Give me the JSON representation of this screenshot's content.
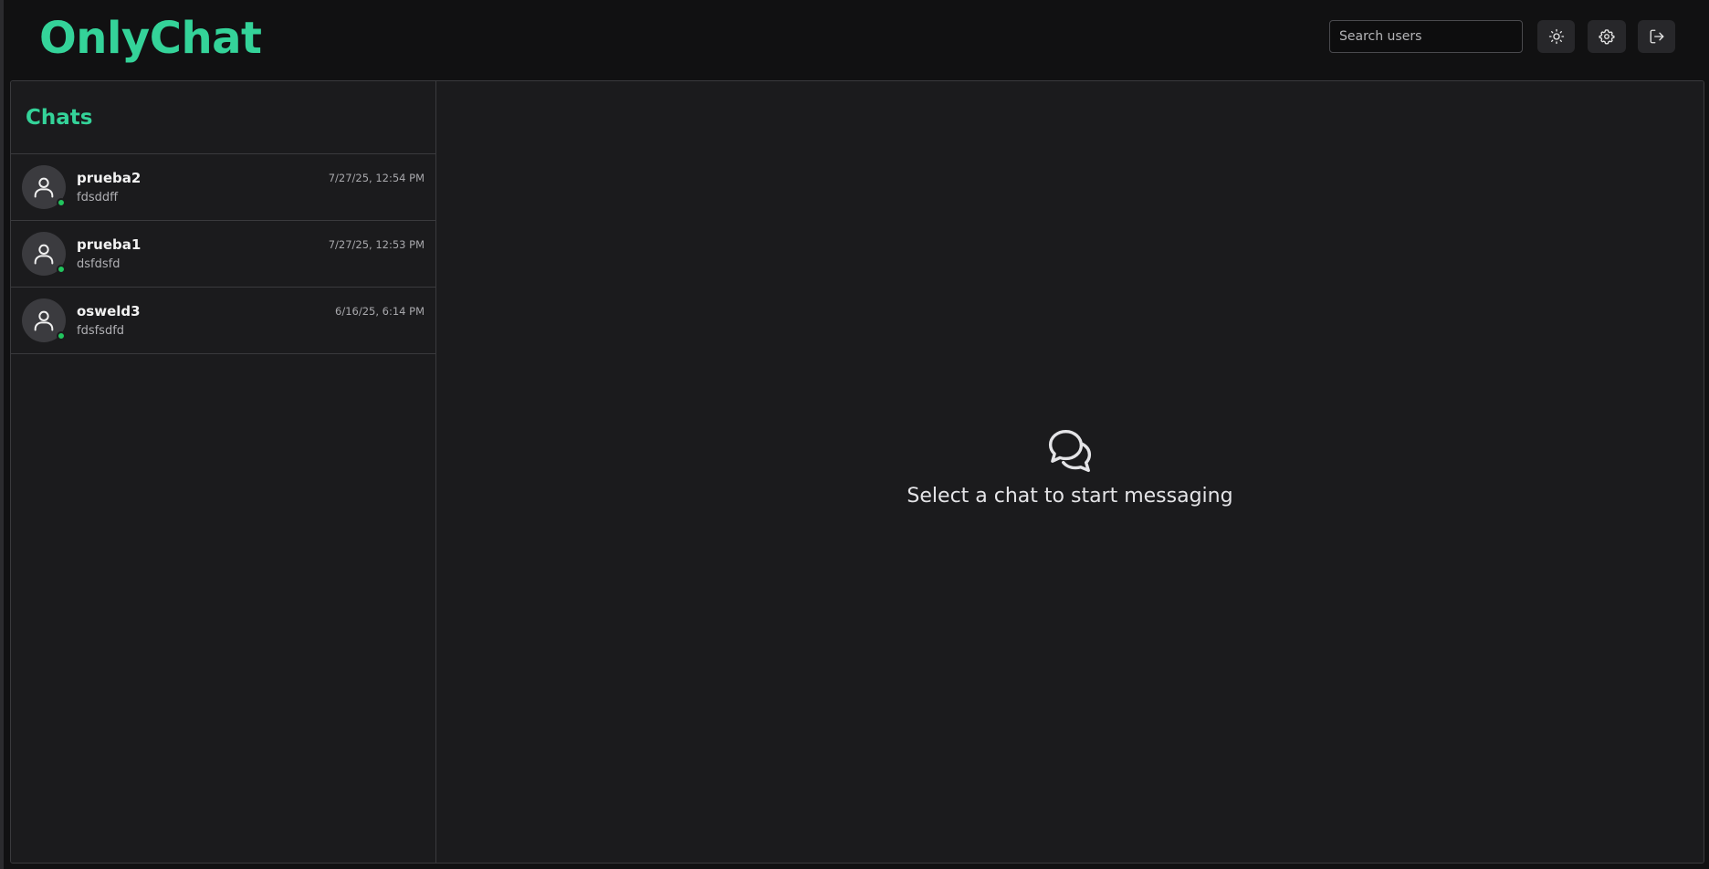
{
  "app": {
    "brand": "OnlyChat"
  },
  "header": {
    "search_placeholder": "Search users",
    "icons": {
      "theme": "sun-icon",
      "settings": "gear-icon",
      "logout": "logout-icon"
    }
  },
  "sidebar": {
    "title": "Chats",
    "chats": [
      {
        "name": "prueba2",
        "preview": "fdsddff",
        "time": "7/27/25, 12:54 PM",
        "online": true
      },
      {
        "name": "prueba1",
        "preview": "dsfdsfd",
        "time": "7/27/25, 12:53 PM",
        "online": true
      },
      {
        "name": "osweld3",
        "preview": "fdsfsdfd",
        "time": "6/16/25, 6:14 PM",
        "online": true
      }
    ]
  },
  "main": {
    "empty_icon": "chat-bubbles-icon",
    "empty_text": "Select a chat to start messaging"
  },
  "colors": {
    "accent": "#34d399",
    "online": "#22c55e",
    "background": "#111112",
    "panel": "#1b1b1d"
  }
}
